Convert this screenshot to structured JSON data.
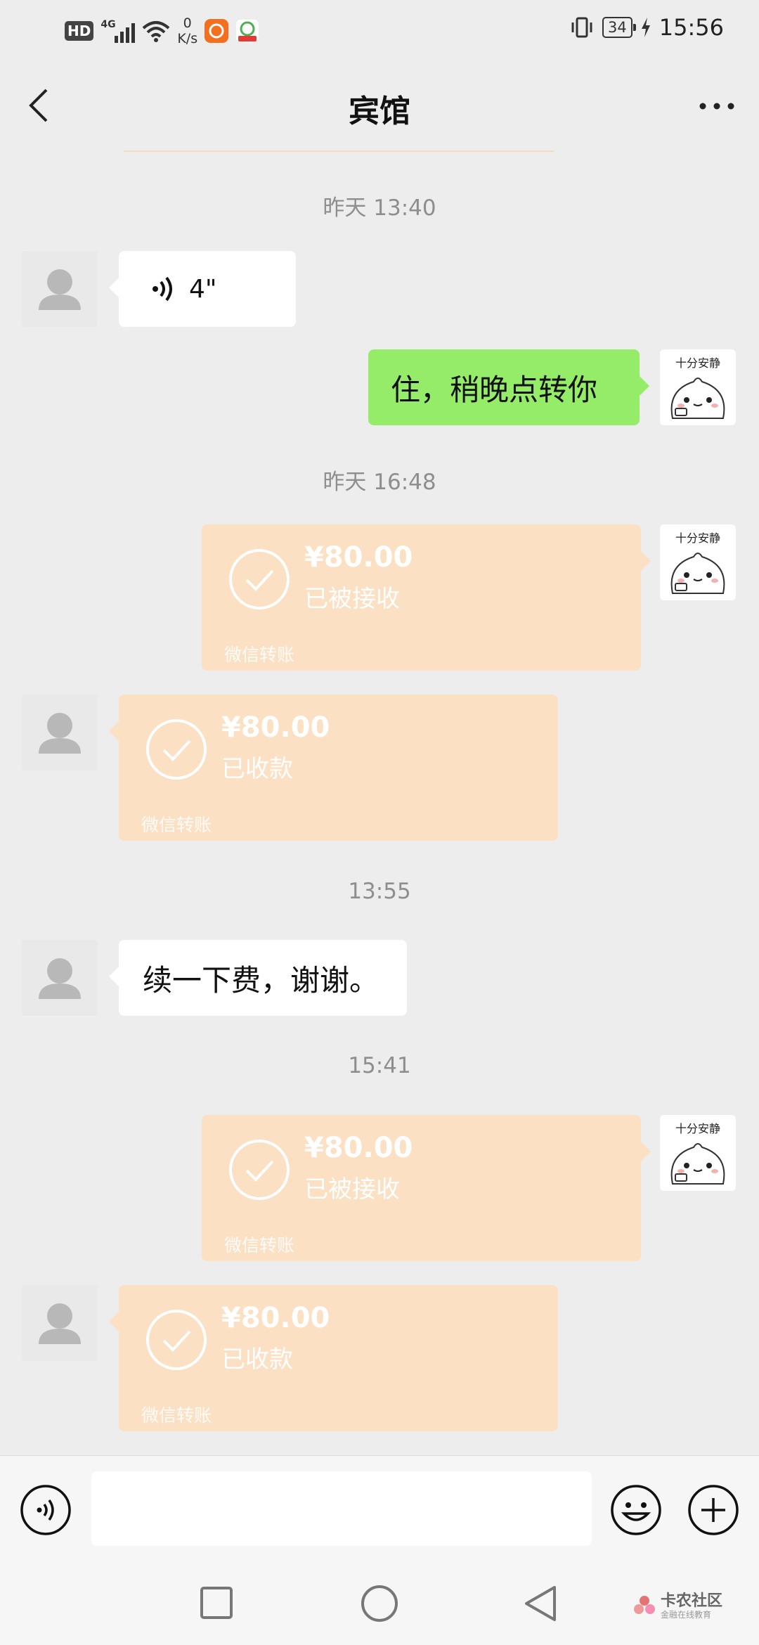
{
  "status_bar": {
    "hd": "HD",
    "network": "4G",
    "speed_value": "0",
    "speed_unit": "K/s",
    "battery": "34",
    "time": "15:56"
  },
  "header": {
    "title": "宾馆"
  },
  "timestamps": [
    "昨天 13:40",
    "昨天 16:48",
    "13:55",
    "15:41"
  ],
  "messages": {
    "voice_duration": "4\"",
    "reply_text": "住，稍晚点转你",
    "renew_text": "续一下费，谢谢。",
    "my_avatar_caption": "十分安静"
  },
  "transfers": [
    {
      "amount": "¥80.00",
      "status": "已被接收",
      "footer": "微信转账"
    },
    {
      "amount": "¥80.00",
      "status": "已收款",
      "footer": "微信转账"
    },
    {
      "amount": "¥80.00",
      "status": "已被接收",
      "footer": "微信转账"
    },
    {
      "amount": "¥80.00",
      "status": "已收款",
      "footer": "微信转账"
    }
  ],
  "watermark": {
    "name": "卡农社区",
    "tagline": "金融在线教育"
  },
  "colors": {
    "background": "#ededed",
    "my_bubble": "#95ec69",
    "transfer_bubble": "#fbe0c3"
  }
}
